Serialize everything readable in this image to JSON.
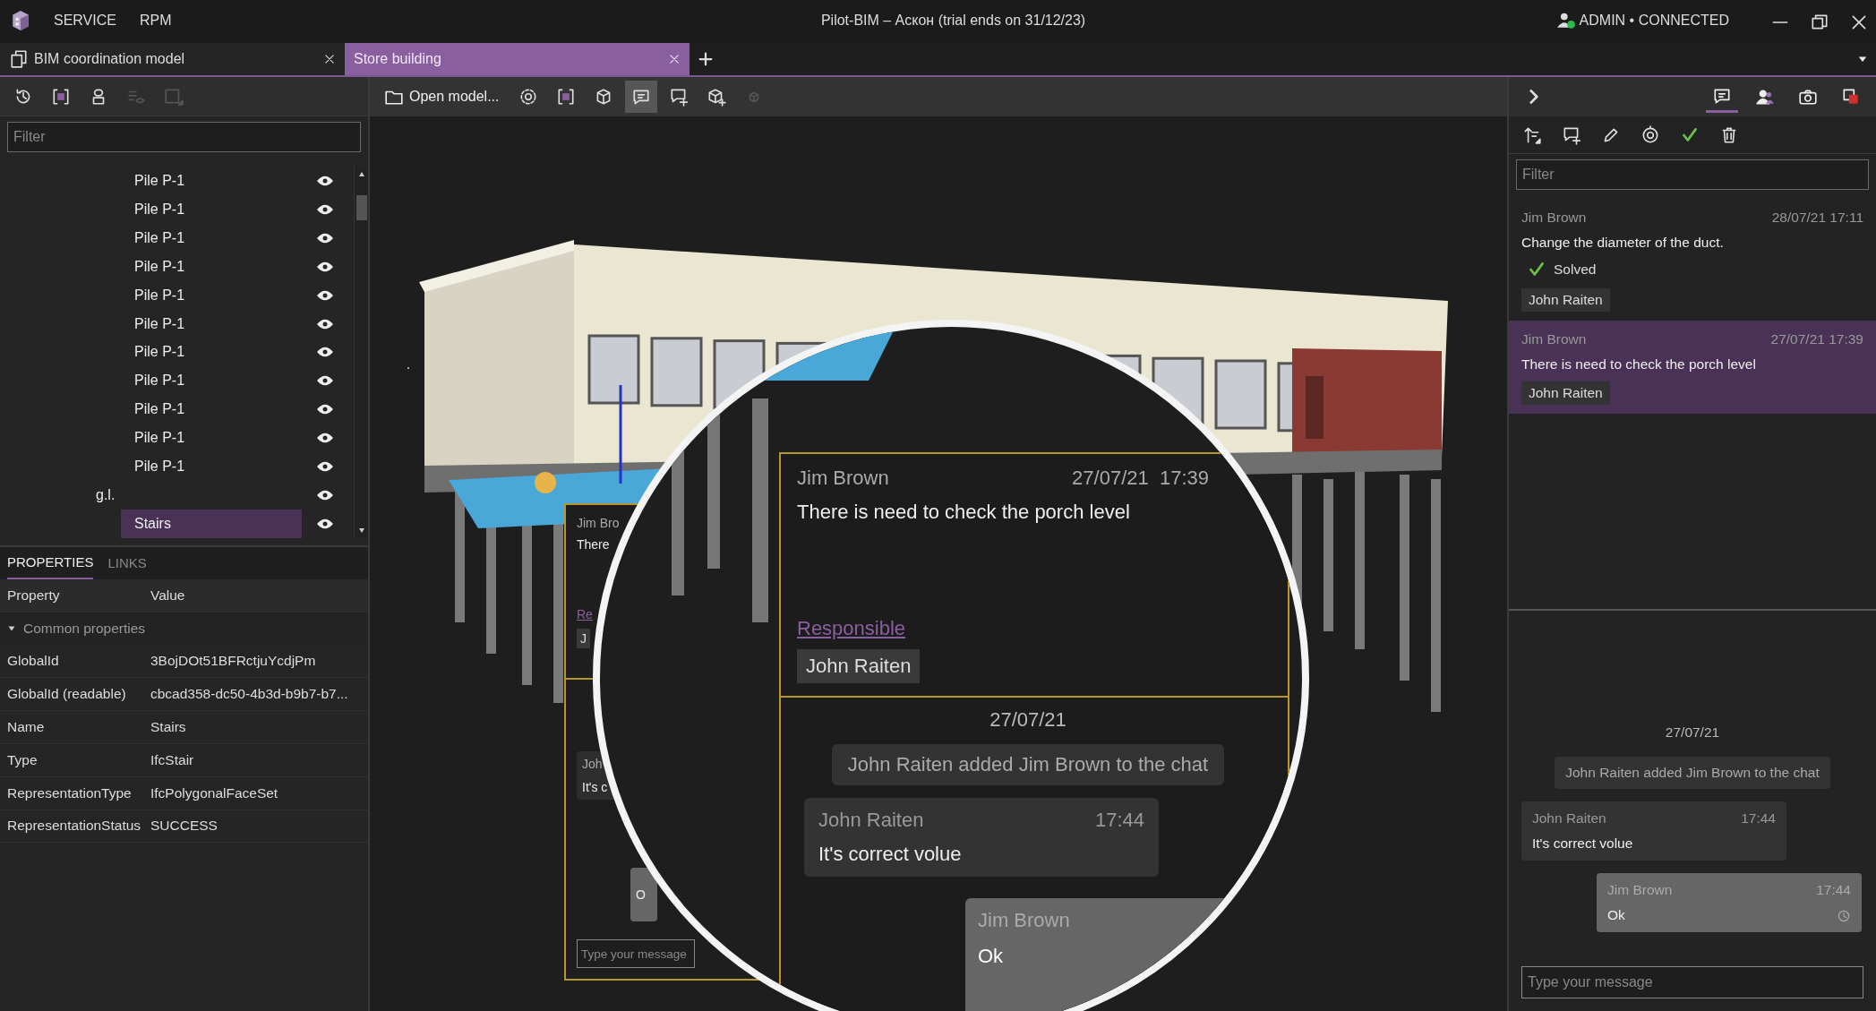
{
  "title_bar": {
    "menu": [
      "SERVICE",
      "RPM"
    ],
    "title": "Pilot-BIM – Аскон (trial ends on 31/12/23)",
    "user_status": "ADMIN • CONNECTED"
  },
  "document_tabs": [
    {
      "label": "BIM coordination model",
      "selected": false
    },
    {
      "label": "Store building",
      "selected": true
    }
  ],
  "model_tree": {
    "tools": [
      {
        "kind": "clock-arrow",
        "disabled": false
      },
      {
        "kind": "bracket-square",
        "disabled": false
      },
      {
        "kind": "stacked-boxes",
        "disabled": false
      },
      {
        "kind": "list-eye",
        "disabled": true
      },
      {
        "kind": "square-corner",
        "disabled": true
      }
    ],
    "filter_placeholder": "Filter",
    "continued_items": [
      {
        "label": "Pile P-1",
        "selected": false
      },
      {
        "label": "Pile P-1",
        "selected": false
      },
      {
        "label": "Pile P-1",
        "selected": false
      },
      {
        "label": "Pile P-1",
        "selected": false
      },
      {
        "label": "Pile P-1",
        "selected": false
      },
      {
        "label": "Pile P-1",
        "selected": false
      },
      {
        "label": "Pile P-1",
        "selected": false
      },
      {
        "label": "Pile P-1",
        "selected": false
      },
      {
        "label": "Pile P-1",
        "selected": false
      },
      {
        "label": "Pile P-1",
        "selected": false
      },
      {
        "label": "Pile P-1",
        "selected": false
      }
    ],
    "items": [
      {
        "label": "g.l.",
        "selected": false,
        "children": [
          {
            "label": "Stairs",
            "selected": true
          }
        ]
      }
    ]
  },
  "properties": {
    "tabs": [
      {
        "label": "PROPERTIES",
        "selected": true
      },
      {
        "label": "LINKS",
        "selected": false
      }
    ],
    "columns": [
      "Property",
      "Value"
    ],
    "groups": [
      {
        "label": "Common properties",
        "expanded": true,
        "rows": [
          {
            "property": "GlobalId",
            "value": "3BojDOt51BFRctjuYcdjPm"
          },
          {
            "property": "GlobalId (readable)",
            "value": "cbcad358-dc50-4b3d-b9b7-b7..."
          },
          {
            "property": "Name",
            "value": "Stairs"
          },
          {
            "property": "Type",
            "value": "IfcStair"
          },
          {
            "property": "RepresentationType",
            "value": "IfcPolygonalFaceSet"
          },
          {
            "property": "RepresentationStatus",
            "value": "SUCCESS"
          }
        ]
      }
    ]
  },
  "viewer": {
    "open_button": "Open model...",
    "tools": [
      {
        "kind": "gear",
        "selected": false,
        "disabled": false
      },
      {
        "kind": "bracket-square",
        "selected": false,
        "disabled": false
      },
      {
        "kind": "cube",
        "selected": false,
        "disabled": false
      },
      {
        "kind": "comment",
        "selected": true,
        "disabled": false
      },
      {
        "kind": "comment-plus",
        "selected": false,
        "disabled": false
      },
      {
        "kind": "cube-plus",
        "selected": false,
        "disabled": false
      },
      {
        "kind": "small-cube",
        "selected": false,
        "disabled": true
      }
    ],
    "issue_popup": {
      "author": "Jim Bro",
      "text": "There",
      "link": "Re",
      "assignee": "J",
      "message_author": "Joh",
      "message_text": "It's c",
      "own_message": "O",
      "placeholder": "Type your message"
    },
    "magnifier": {
      "author": "Jim Brown",
      "datetime": "27/07/21  17:39",
      "text": "There is need to check the porch level",
      "link": "Responsible",
      "assignee": "John Raiten",
      "chat": {
        "date": "27/07/21",
        "messages": [
          {
            "kind": "system",
            "text": "John Raiten added Jim Brown to the chat"
          },
          {
            "kind": "incoming",
            "author": "John Raiten",
            "time": "17:44",
            "text": "It's correct volue"
          },
          {
            "kind": "outgoing",
            "author": "Jim Brown",
            "text": "Ok"
          }
        ]
      }
    }
  },
  "side_panel": {
    "tabs": [
      {
        "kind": "comment",
        "selected": true
      },
      {
        "kind": "users",
        "selected": false
      },
      {
        "kind": "camera",
        "selected": false
      },
      {
        "kind": "overlap-squares",
        "selected": false
      }
    ],
    "tools": [
      {
        "kind": "sort"
      },
      {
        "kind": "comment-plus"
      },
      {
        "kind": "pencil"
      },
      {
        "kind": "target"
      },
      {
        "kind": "check"
      },
      {
        "kind": "trash"
      }
    ],
    "filter_placeholder": "Filter",
    "issues": [
      {
        "author": "Jim Brown",
        "datetime": "28/07/21 17:11",
        "text": "Change the diameter of the duct.",
        "status": "Solved",
        "assignee": "John Raiten",
        "selected": false
      },
      {
        "author": "Jim Brown",
        "datetime": "27/07/21 17:39",
        "text": "There is need to check the porch level",
        "assignee": "John Raiten",
        "selected": true
      }
    ],
    "chat": {
      "date": "27/07/21",
      "messages": [
        {
          "kind": "system",
          "text": "John Raiten added Jim Brown to the chat"
        },
        {
          "kind": "incoming",
          "author": "John Raiten",
          "time": "17:44",
          "text": "It's correct volue"
        },
        {
          "kind": "outgoing",
          "author": "Jim Brown",
          "time": "17:44",
          "text": "Ok"
        }
      ]
    },
    "message_placeholder": "Type your message"
  }
}
